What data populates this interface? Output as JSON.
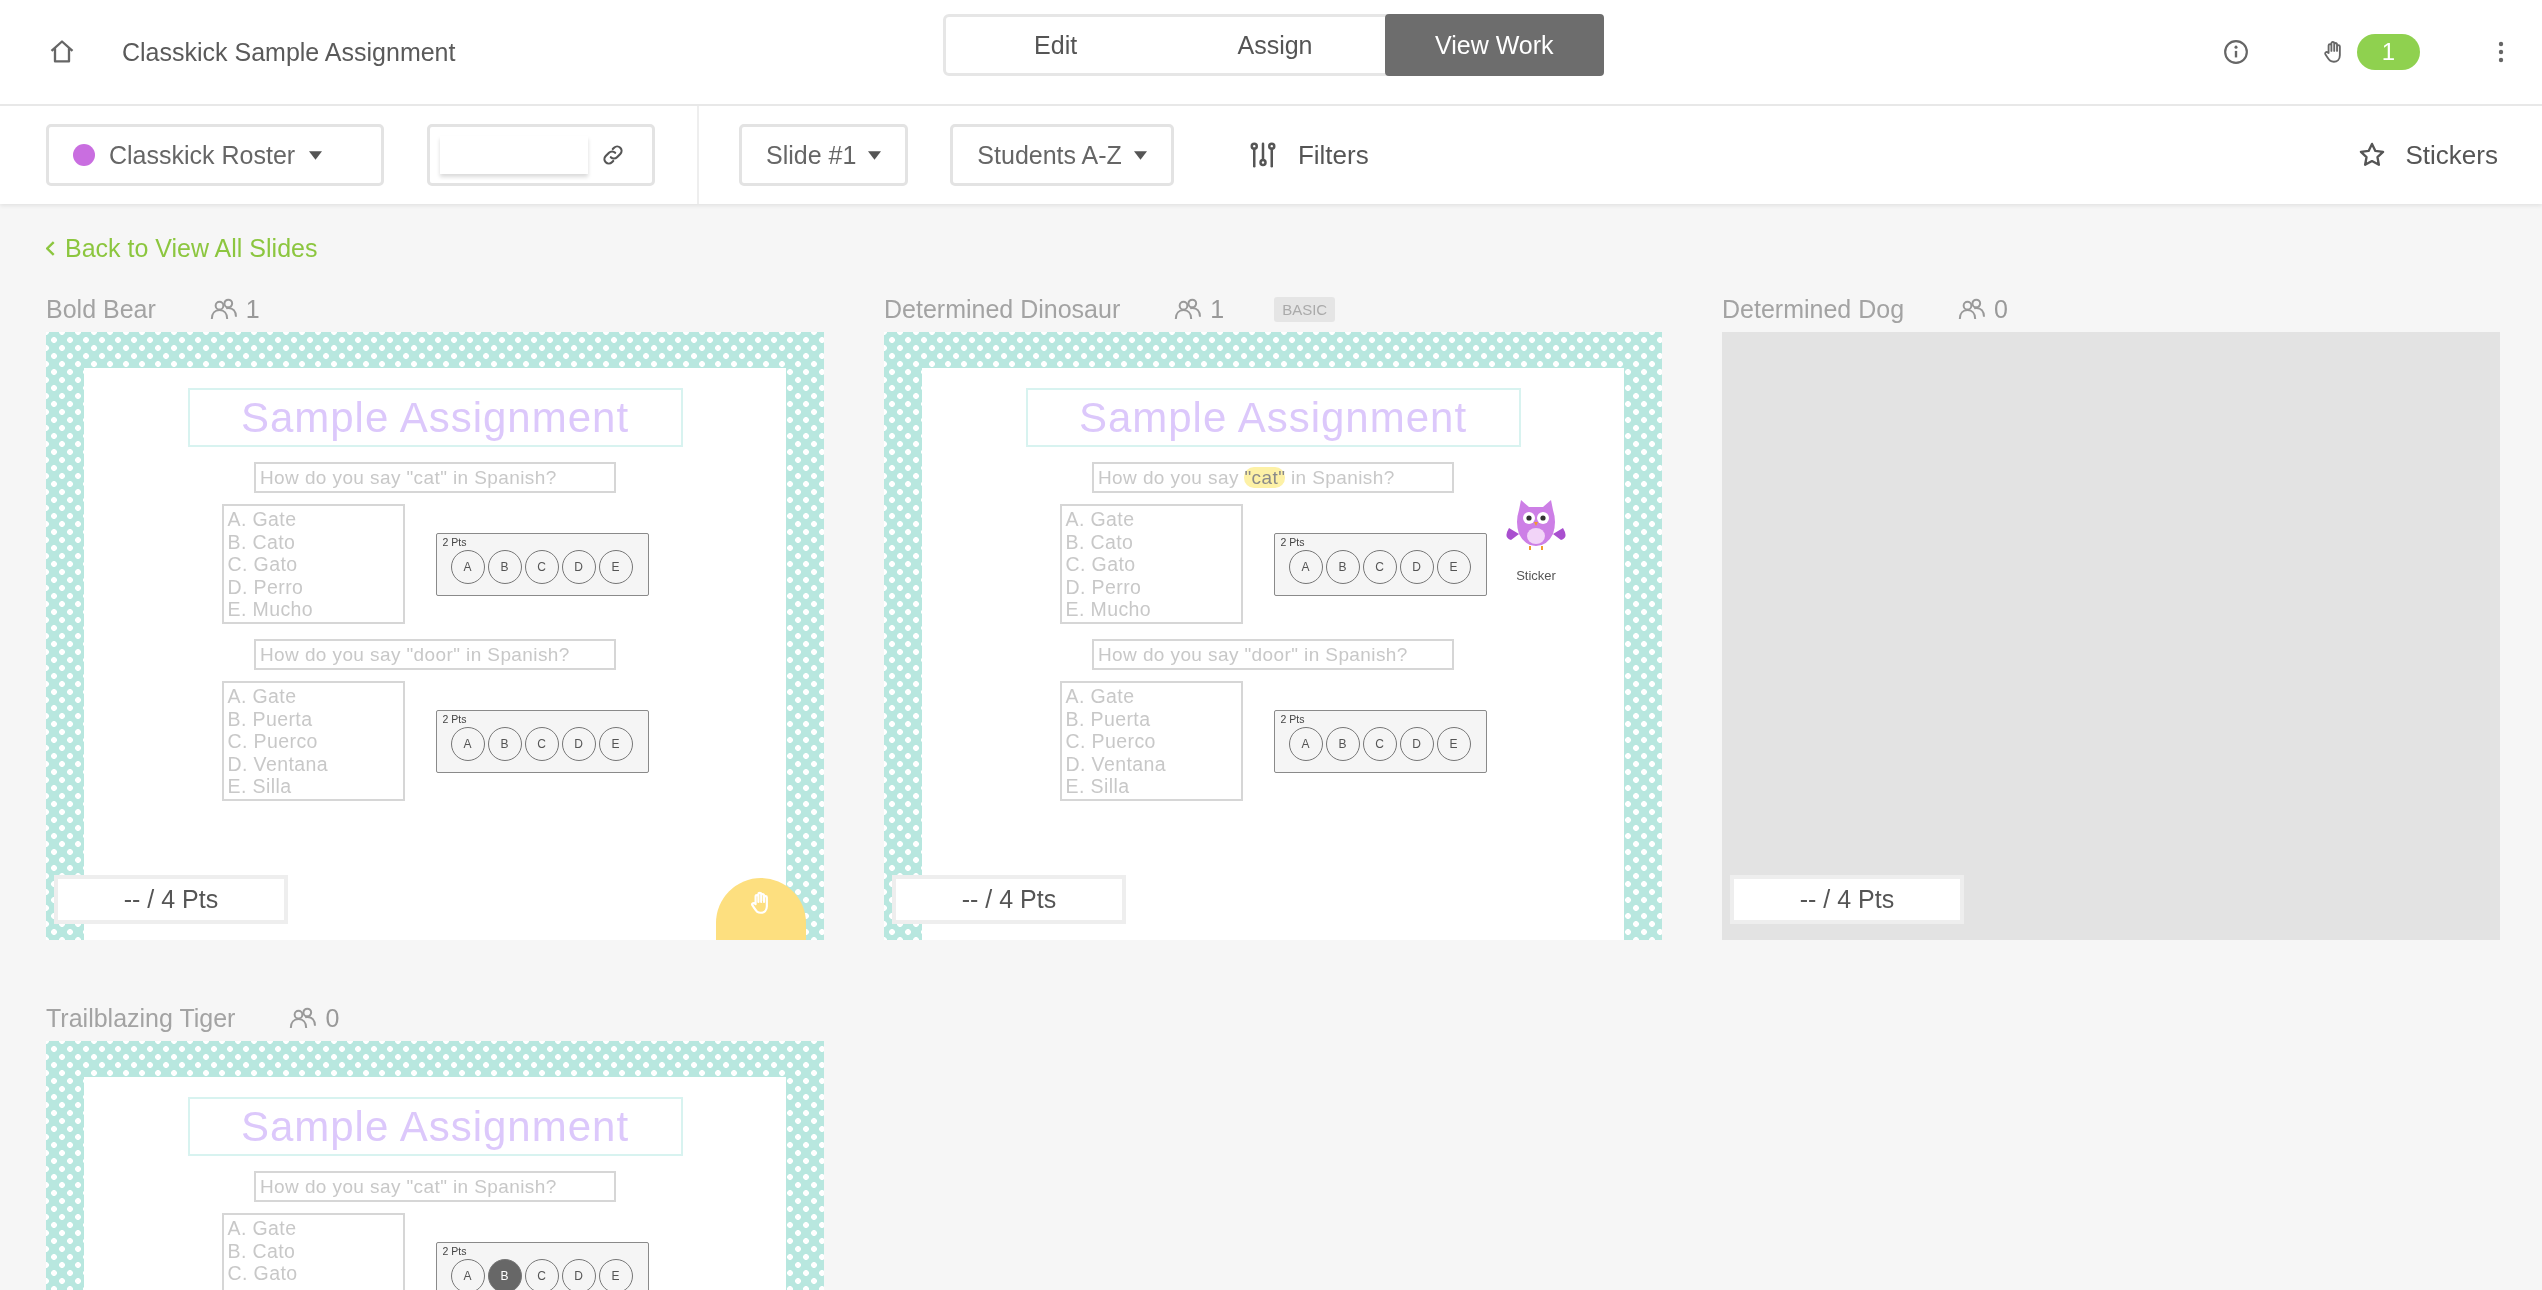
{
  "header": {
    "title": "Classkick Sample Assignment",
    "tabs": [
      {
        "label": "Edit",
        "selected": false
      },
      {
        "label": "Assign",
        "selected": false
      },
      {
        "label": "View Work",
        "selected": true
      }
    ],
    "help_count": "1"
  },
  "toolbar": {
    "roster": {
      "label": "Classkick Roster",
      "color": "#c96ee0"
    },
    "slide_select": "Slide #1",
    "sort_select": "Students A-Z",
    "filters": "Filters",
    "stickers": "Stickers"
  },
  "back_link": "Back to View All Slides",
  "students": [
    {
      "name": "Bold Bear",
      "viewers": "1",
      "score": "-- / 4 Pts",
      "hand_raised": true,
      "slide": {
        "kind": "assignment",
        "title": "Sample Assignment",
        "questions": [
          {
            "prompt": [
              {
                "text": "How do you say \"cat\" in Spanish?",
                "highlighted": false
              }
            ],
            "options": [
              "A. Gate",
              "B. Cato",
              "C. Gato",
              "D. Perro",
              "E. Mucho"
            ],
            "answer": {
              "points": "2 Pts",
              "bubbles": [
                {
                  "label": "A",
                  "selected": false
                },
                {
                  "label": "B",
                  "selected": false
                },
                {
                  "label": "C",
                  "selected": false
                },
                {
                  "label": "D",
                  "selected": false
                },
                {
                  "label": "E",
                  "selected": false
                }
              ]
            }
          },
          {
            "prompt": [
              {
                "text": "How do you say \"door\" in Spanish?",
                "highlighted": false
              }
            ],
            "options": [
              "A. Gate",
              "B. Puerta",
              "C. Puerco",
              "D. Ventana",
              "E. Silla"
            ],
            "answer": {
              "points": "2 Pts",
              "bubbles": [
                {
                  "label": "A",
                  "selected": false
                },
                {
                  "label": "B",
                  "selected": false
                },
                {
                  "label": "C",
                  "selected": false
                },
                {
                  "label": "D",
                  "selected": false
                },
                {
                  "label": "E",
                  "selected": false
                }
              ]
            }
          }
        ]
      }
    },
    {
      "name": "Determined Dinosaur",
      "viewers": "1",
      "badge": "BASIC",
      "score": "-- / 4 Pts",
      "hand_raised": false,
      "slide": {
        "kind": "assignment",
        "title": "Sample Assignment",
        "sticker": {
          "label": "Sticker"
        },
        "questions": [
          {
            "prompt": [
              {
                "text": "How do you say ",
                "highlighted": false
              },
              {
                "text": "\"cat\"",
                "highlighted": true
              },
              {
                "text": " in Spanish?",
                "highlighted": false
              }
            ],
            "options": [
              "A. Gate",
              "B. Cato",
              "C. Gato",
              "D. Perro",
              "E. Mucho"
            ],
            "answer": {
              "points": "2 Pts",
              "bubbles": [
                {
                  "label": "A",
                  "selected": false
                },
                {
                  "label": "B",
                  "selected": false
                },
                {
                  "label": "C",
                  "selected": false
                },
                {
                  "label": "D",
                  "selected": false
                },
                {
                  "label": "E",
                  "selected": false
                }
              ]
            }
          },
          {
            "prompt": [
              {
                "text": "How do you say \"door\" in Spanish?",
                "highlighted": false
              }
            ],
            "options": [
              "A. Gate",
              "B. Puerta",
              "C. Puerco",
              "D. Ventana",
              "E. Silla"
            ],
            "answer": {
              "points": "2 Pts",
              "bubbles": [
                {
                  "label": "A",
                  "selected": false
                },
                {
                  "label": "B",
                  "selected": false
                },
                {
                  "label": "C",
                  "selected": false
                },
                {
                  "label": "D",
                  "selected": false
                },
                {
                  "label": "E",
                  "selected": false
                }
              ]
            }
          }
        ]
      }
    },
    {
      "name": "Determined Dog",
      "viewers": "0",
      "score": "-- / 4 Pts",
      "hand_raised": false,
      "slide": {
        "kind": "blank"
      }
    },
    {
      "name": "Trailblazing Tiger",
      "viewers": "0",
      "hand_raised": false,
      "slide": {
        "kind": "assignment",
        "title": "Sample Assignment",
        "questions": [
          {
            "prompt": [
              {
                "text": "How do you say \"cat\" in Spanish?",
                "highlighted": false
              }
            ],
            "options": [
              "A. Gate",
              "B. Cato",
              "C. Gato"
            ],
            "answer": {
              "points": "2 Pts",
              "bubbles": [
                {
                  "label": "A",
                  "selected": false
                },
                {
                  "label": "B",
                  "selected": true
                },
                {
                  "label": "C",
                  "selected": false
                },
                {
                  "label": "D",
                  "selected": false
                },
                {
                  "label": "E",
                  "selected": false
                }
              ]
            }
          }
        ]
      }
    }
  ]
}
